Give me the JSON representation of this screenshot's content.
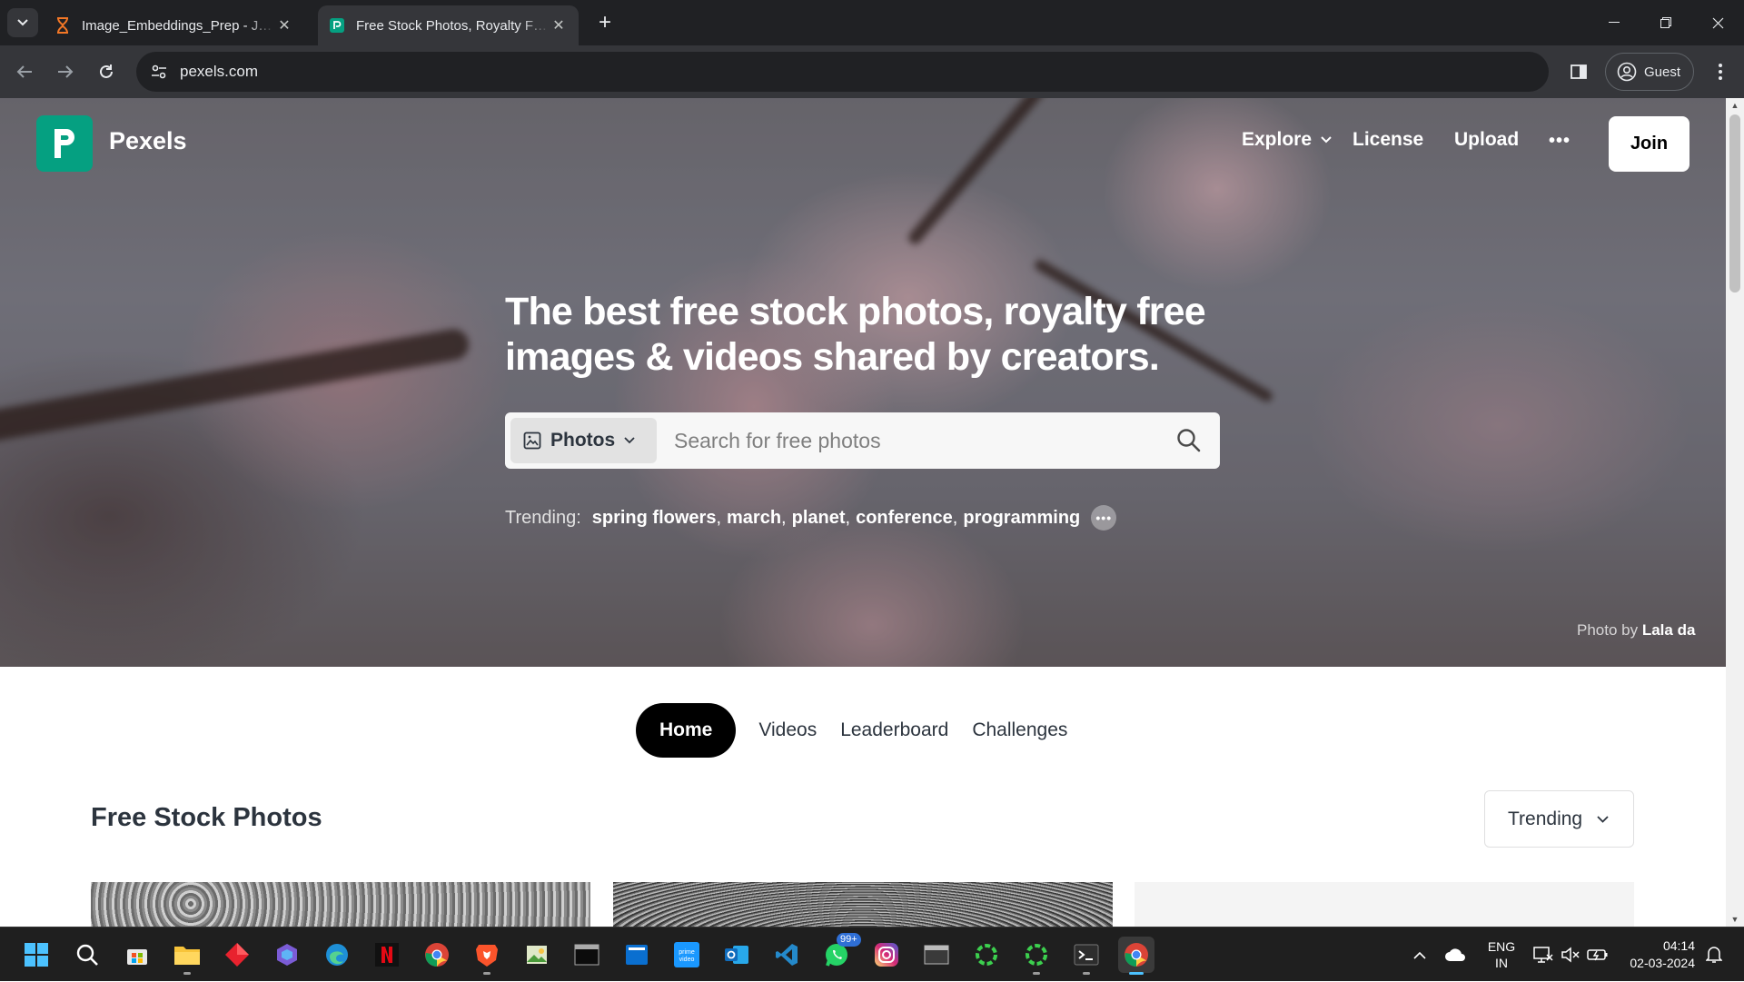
{
  "browser": {
    "tabs": [
      {
        "title": "Image_Embeddings_Prep - Jupyter",
        "active": false
      },
      {
        "title": "Free Stock Photos, Royalty Free Stock Images",
        "active": true
      }
    ],
    "new_tab": "+",
    "address": "pexels.com",
    "profile": "Guest"
  },
  "site": {
    "brand": "Pexels",
    "nav": {
      "explore": "Explore",
      "license": "License",
      "upload": "Upload",
      "more": "•••",
      "join": "Join"
    },
    "hero": {
      "headline": "The best free stock photos, royalty free images & videos shared by creators.",
      "search_type": "Photos",
      "search_placeholder": "Search for free photos",
      "trending_label": "Trending:",
      "trending": [
        "spring flowers",
        "march",
        "planet",
        "conference",
        "programming"
      ],
      "credit_prefix": "Photo by",
      "credit_name": "Lala da"
    },
    "subtabs": [
      "Home",
      "Videos",
      "Leaderboard",
      "Challenges"
    ],
    "section_title": "Free Stock Photos",
    "sort": "Trending"
  },
  "taskbar": {
    "whatsapp_badge": "99+",
    "language": "ENG",
    "region": "IN",
    "time": "04:14",
    "date": "02-03-2024"
  },
  "colors": {
    "brand_green": "#05a081",
    "chrome_dark": "#202124",
    "chrome_toolbar": "#35363a"
  }
}
